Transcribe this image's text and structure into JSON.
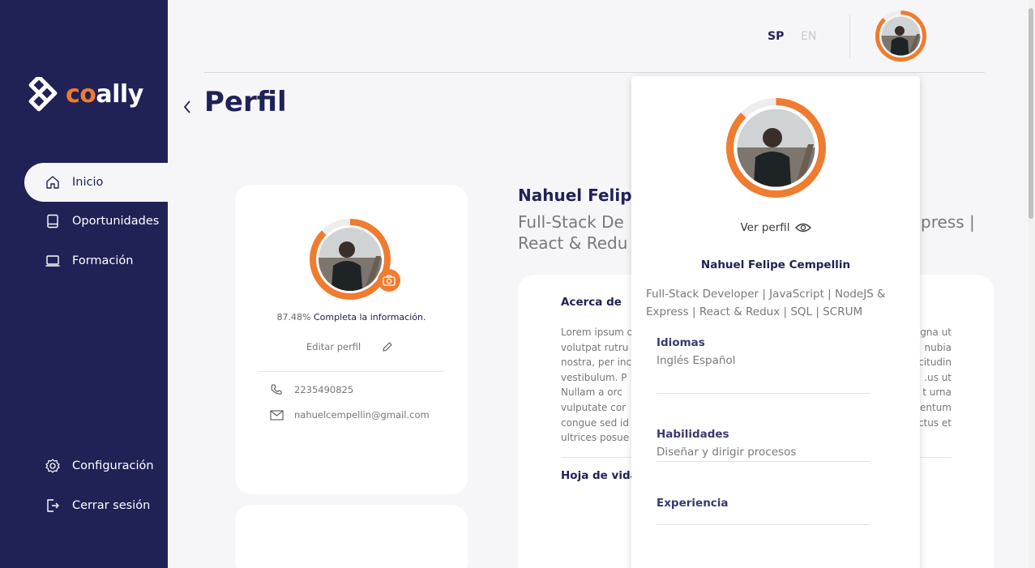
{
  "sidebar": {
    "logo": {
      "co": "co",
      "ally": "ally"
    },
    "items": [
      {
        "label": "Inicio",
        "icon": "home-icon"
      },
      {
        "label": "Oportunidades",
        "icon": "book-icon"
      },
      {
        "label": "Formación",
        "icon": "laptop-icon"
      }
    ],
    "bottom_items": [
      {
        "label": "Configuración",
        "icon": "gear-icon"
      },
      {
        "label": "Cerrar sesión",
        "icon": "logout-icon"
      }
    ]
  },
  "topbar": {
    "lang_sp": "SP",
    "lang_en": "EN"
  },
  "page": {
    "title": "Perfil"
  },
  "profile_card": {
    "completion_pct": "87.48%",
    "completion_msg": "Completa la información.",
    "edit_label": "Editar perfil",
    "phone": "2235490825",
    "email": "nahuelcempellin@gmail.com"
  },
  "main": {
    "name": "Nahuel Felipe",
    "headline_line1": "Full-Stack De",
    "headline_line1_end": "press |",
    "headline_line2": "React & Redu",
    "about_title": "Acerca de",
    "about_left": [
      "Lorem ipsum d",
      "volutpat rutru",
      "nostra, per inc",
      "vestibulum. P",
      "Nullam a orc",
      "vulputate cor",
      "congue sed id",
      "ultrices posue"
    ],
    "about_right": [
      "gna ut",
      "nubia",
      "citudin",
      "us ut.",
      "t urna",
      "entum",
      "ctus et",
      ""
    ],
    "cv_title": "Hoja de vida"
  },
  "dropdown": {
    "ver_perfil": "Ver perfil",
    "name": "Nahuel Felipe Cempellin",
    "headline": "Full-Stack Developer | JavaScript | NodeJS & Express | React & Redux | SQL | SCRUM",
    "idiomas_title": "Idiomas",
    "idiomas_value": "Inglés  Español",
    "habilidades_title": "Habilidades",
    "habilidades_value": "Diseñar y dirigir procesos",
    "experiencia_title": "Experiencia"
  },
  "colors": {
    "navy": "#202256",
    "orange": "#ef7c2f",
    "bg": "#f6f6f8"
  },
  "profile_ring_progress": 0.8748
}
